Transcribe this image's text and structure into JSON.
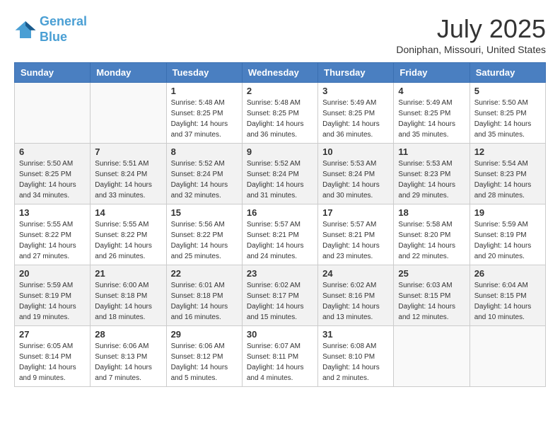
{
  "logo": {
    "line1": "General",
    "line2": "Blue"
  },
  "title": "July 2025",
  "subtitle": "Doniphan, Missouri, United States",
  "weekdays": [
    "Sunday",
    "Monday",
    "Tuesday",
    "Wednesday",
    "Thursday",
    "Friday",
    "Saturday"
  ],
  "weeks": [
    [
      {
        "day": "",
        "info": ""
      },
      {
        "day": "",
        "info": ""
      },
      {
        "day": "1",
        "info": "Sunrise: 5:48 AM\nSunset: 8:25 PM\nDaylight: 14 hours\nand 37 minutes."
      },
      {
        "day": "2",
        "info": "Sunrise: 5:48 AM\nSunset: 8:25 PM\nDaylight: 14 hours\nand 36 minutes."
      },
      {
        "day": "3",
        "info": "Sunrise: 5:49 AM\nSunset: 8:25 PM\nDaylight: 14 hours\nand 36 minutes."
      },
      {
        "day": "4",
        "info": "Sunrise: 5:49 AM\nSunset: 8:25 PM\nDaylight: 14 hours\nand 35 minutes."
      },
      {
        "day": "5",
        "info": "Sunrise: 5:50 AM\nSunset: 8:25 PM\nDaylight: 14 hours\nand 35 minutes."
      }
    ],
    [
      {
        "day": "6",
        "info": "Sunrise: 5:50 AM\nSunset: 8:25 PM\nDaylight: 14 hours\nand 34 minutes."
      },
      {
        "day": "7",
        "info": "Sunrise: 5:51 AM\nSunset: 8:24 PM\nDaylight: 14 hours\nand 33 minutes."
      },
      {
        "day": "8",
        "info": "Sunrise: 5:52 AM\nSunset: 8:24 PM\nDaylight: 14 hours\nand 32 minutes."
      },
      {
        "day": "9",
        "info": "Sunrise: 5:52 AM\nSunset: 8:24 PM\nDaylight: 14 hours\nand 31 minutes."
      },
      {
        "day": "10",
        "info": "Sunrise: 5:53 AM\nSunset: 8:24 PM\nDaylight: 14 hours\nand 30 minutes."
      },
      {
        "day": "11",
        "info": "Sunrise: 5:53 AM\nSunset: 8:23 PM\nDaylight: 14 hours\nand 29 minutes."
      },
      {
        "day": "12",
        "info": "Sunrise: 5:54 AM\nSunset: 8:23 PM\nDaylight: 14 hours\nand 28 minutes."
      }
    ],
    [
      {
        "day": "13",
        "info": "Sunrise: 5:55 AM\nSunset: 8:22 PM\nDaylight: 14 hours\nand 27 minutes."
      },
      {
        "day": "14",
        "info": "Sunrise: 5:55 AM\nSunset: 8:22 PM\nDaylight: 14 hours\nand 26 minutes."
      },
      {
        "day": "15",
        "info": "Sunrise: 5:56 AM\nSunset: 8:22 PM\nDaylight: 14 hours\nand 25 minutes."
      },
      {
        "day": "16",
        "info": "Sunrise: 5:57 AM\nSunset: 8:21 PM\nDaylight: 14 hours\nand 24 minutes."
      },
      {
        "day": "17",
        "info": "Sunrise: 5:57 AM\nSunset: 8:21 PM\nDaylight: 14 hours\nand 23 minutes."
      },
      {
        "day": "18",
        "info": "Sunrise: 5:58 AM\nSunset: 8:20 PM\nDaylight: 14 hours\nand 22 minutes."
      },
      {
        "day": "19",
        "info": "Sunrise: 5:59 AM\nSunset: 8:19 PM\nDaylight: 14 hours\nand 20 minutes."
      }
    ],
    [
      {
        "day": "20",
        "info": "Sunrise: 5:59 AM\nSunset: 8:19 PM\nDaylight: 14 hours\nand 19 minutes."
      },
      {
        "day": "21",
        "info": "Sunrise: 6:00 AM\nSunset: 8:18 PM\nDaylight: 14 hours\nand 18 minutes."
      },
      {
        "day": "22",
        "info": "Sunrise: 6:01 AM\nSunset: 8:18 PM\nDaylight: 14 hours\nand 16 minutes."
      },
      {
        "day": "23",
        "info": "Sunrise: 6:02 AM\nSunset: 8:17 PM\nDaylight: 14 hours\nand 15 minutes."
      },
      {
        "day": "24",
        "info": "Sunrise: 6:02 AM\nSunset: 8:16 PM\nDaylight: 14 hours\nand 13 minutes."
      },
      {
        "day": "25",
        "info": "Sunrise: 6:03 AM\nSunset: 8:15 PM\nDaylight: 14 hours\nand 12 minutes."
      },
      {
        "day": "26",
        "info": "Sunrise: 6:04 AM\nSunset: 8:15 PM\nDaylight: 14 hours\nand 10 minutes."
      }
    ],
    [
      {
        "day": "27",
        "info": "Sunrise: 6:05 AM\nSunset: 8:14 PM\nDaylight: 14 hours\nand 9 minutes."
      },
      {
        "day": "28",
        "info": "Sunrise: 6:06 AM\nSunset: 8:13 PM\nDaylight: 14 hours\nand 7 minutes."
      },
      {
        "day": "29",
        "info": "Sunrise: 6:06 AM\nSunset: 8:12 PM\nDaylight: 14 hours\nand 5 minutes."
      },
      {
        "day": "30",
        "info": "Sunrise: 6:07 AM\nSunset: 8:11 PM\nDaylight: 14 hours\nand 4 minutes."
      },
      {
        "day": "31",
        "info": "Sunrise: 6:08 AM\nSunset: 8:10 PM\nDaylight: 14 hours\nand 2 minutes."
      },
      {
        "day": "",
        "info": ""
      },
      {
        "day": "",
        "info": ""
      }
    ]
  ]
}
